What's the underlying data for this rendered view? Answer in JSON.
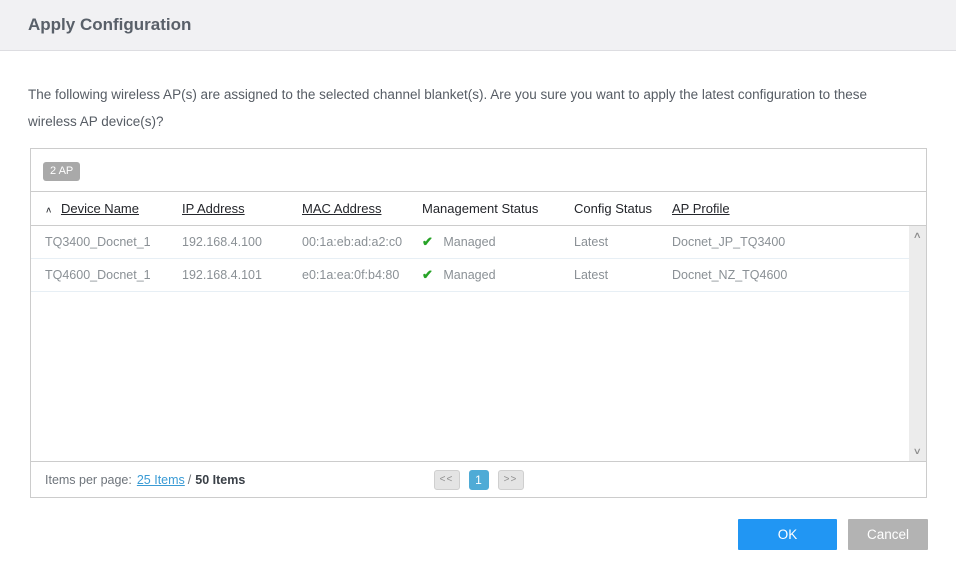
{
  "header": {
    "title": "Apply Configuration"
  },
  "message": "The following wireless AP(s) are assigned to the selected channel blanket(s). Are you sure you want to apply the latest configuration to these wireless AP device(s)?",
  "table": {
    "count_badge": "2 AP",
    "columns": [
      {
        "label": "Device Name"
      },
      {
        "label": "IP Address"
      },
      {
        "label": "MAC Address"
      },
      {
        "label": "Management Status"
      },
      {
        "label": "Config Status"
      },
      {
        "label": "AP Profile"
      }
    ],
    "rows": [
      {
        "device_name": "TQ3400_Docnet_1",
        "ip_address": "192.168.4.100",
        "mac_address": "00:1a:eb:ad:a2:c0",
        "management_status": "Managed",
        "config_status": "Latest",
        "ap_profile": "Docnet_JP_TQ3400"
      },
      {
        "device_name": "TQ4600_Docnet_1",
        "ip_address": "192.168.4.101",
        "mac_address": "e0:1a:ea:0f:b4:80",
        "management_status": "Managed",
        "config_status": "Latest",
        "ap_profile": "Docnet_NZ_TQ4600"
      }
    ]
  },
  "pagination": {
    "items_per_page_label": "Items per page:",
    "items_per_page_link": "25 Items",
    "separator": "/",
    "total_items": "50 Items",
    "prev_label": "<<",
    "page": "1",
    "next_label": ">>"
  },
  "footer": {
    "ok_label": "OK",
    "cancel_label": "Cancel"
  },
  "icons": {
    "sort_asc": "∧",
    "check": "✔",
    "scroll_up": "∧",
    "scroll_down": "∨"
  },
  "colors": {
    "accent_blue": "#2196f3",
    "page_active_blue": "#4fabd6",
    "check_green": "#27a327",
    "badge_gray": "#a9a9a9"
  }
}
